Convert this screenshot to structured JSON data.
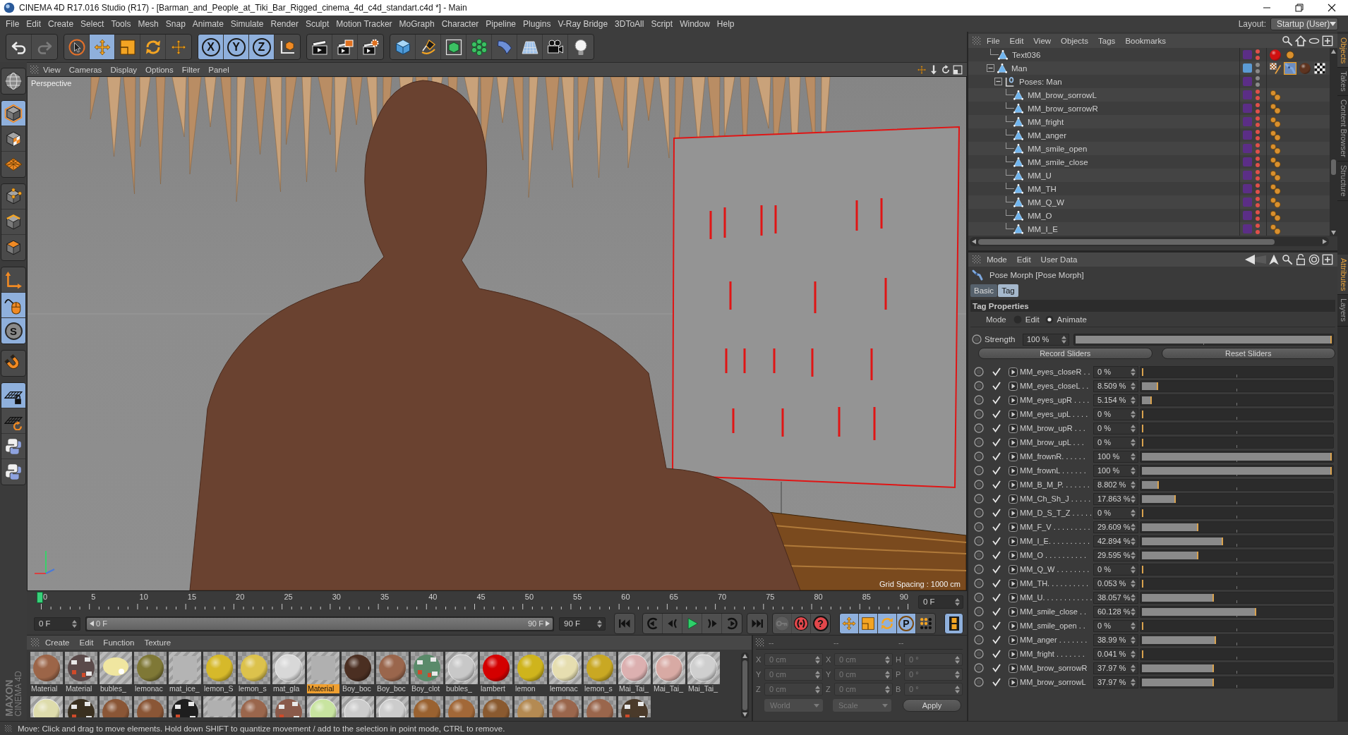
{
  "window": {
    "title": "CINEMA 4D R17.016 Studio (R17) - [Barman_and_People_at_Tiki_Bar_Rigged_cinema_4d_c4d_standart.c4d *] - Main"
  },
  "menu_bar": {
    "items": [
      "File",
      "Edit",
      "Create",
      "Select",
      "Tools",
      "Mesh",
      "Snap",
      "Animate",
      "Simulate",
      "Render",
      "Sculpt",
      "Motion Tracker",
      "MoGraph",
      "Character",
      "Pipeline",
      "Plugins",
      "V-Ray Bridge",
      "3DToAll",
      "Script",
      "Window",
      "Help"
    ],
    "layout_label": "Layout:",
    "layout_value": "Startup (User)"
  },
  "toolbar": {
    "groups": [
      {
        "items": [
          {
            "kind": "undo",
            "disabled": false
          },
          {
            "kind": "redo",
            "disabled": true
          }
        ]
      },
      {
        "items": [
          {
            "kind": "select",
            "selected": false
          },
          {
            "kind": "move",
            "selected": true
          },
          {
            "kind": "scale",
            "selected": false
          },
          {
            "kind": "rotate",
            "selected": false
          },
          {
            "kind": "transform",
            "selected": false
          }
        ]
      },
      {
        "items": [
          {
            "kind": "letter",
            "label": "X",
            "selected": true
          },
          {
            "kind": "letter",
            "label": "Y",
            "selected": true
          },
          {
            "kind": "letter",
            "label": "Z",
            "selected": true
          },
          {
            "kind": "coordinate_system",
            "selected": false
          }
        ]
      },
      {
        "items": [
          {
            "kind": "render_view"
          },
          {
            "kind": "render_picture"
          },
          {
            "kind": "render_settings"
          }
        ]
      },
      {
        "items": [
          {
            "kind": "cube"
          },
          {
            "kind": "pen"
          },
          {
            "kind": "subdivision"
          },
          {
            "kind": "cloner"
          },
          {
            "kind": "deformer"
          },
          {
            "kind": "floor"
          },
          {
            "kind": "camera"
          },
          {
            "kind": "light"
          }
        ]
      }
    ]
  },
  "left_toolbar": {
    "groups": [
      {
        "items": [
          {
            "kind": "globe",
            "selected": false
          }
        ]
      },
      {
        "items": [
          {
            "kind": "model_cube",
            "selected": true
          },
          {
            "kind": "checker_cube",
            "selected": false
          },
          {
            "kind": "grid_plane",
            "selected": false
          }
        ]
      },
      {
        "items": [
          {
            "kind": "cube_points",
            "selected": false
          },
          {
            "kind": "cube_edges",
            "selected": false
          },
          {
            "kind": "cube_faces",
            "selected": false
          }
        ]
      },
      {
        "items": [
          {
            "kind": "axis",
            "selected": false
          },
          {
            "kind": "mouse",
            "selected": true
          },
          {
            "kind": "letter",
            "label": "S",
            "selected": true
          }
        ]
      },
      {
        "items": [
          {
            "kind": "magnet",
            "selected": false
          }
        ]
      },
      {
        "items": [
          {
            "kind": "grid_lock",
            "selected": true
          },
          {
            "kind": "grid_rotate",
            "selected": false
          },
          {
            "kind": "script",
            "selected": false
          },
          {
            "kind": "script",
            "selected": false
          }
        ]
      }
    ],
    "logo": [
      "MAXON",
      "CINEMA 4D"
    ]
  },
  "viewport": {
    "menu": [
      "View",
      "Cameras",
      "Display",
      "Options",
      "Filter",
      "Panel"
    ],
    "camera": "Perspective",
    "grid_spacing": "Grid Spacing : 1000 cm"
  },
  "timeline": {
    "ticks": [
      "0",
      "5",
      "10",
      "15",
      "20",
      "25",
      "30",
      "35",
      "40",
      "45",
      "50",
      "55",
      "60",
      "65",
      "70",
      "75",
      "80",
      "85",
      "90"
    ],
    "level": 0,
    "current_frame": "0 F"
  },
  "transport": {
    "start": "0 F",
    "range": {
      "start": "0 F",
      "end": "90 F",
      "level": 1
    },
    "end": "90 F",
    "playback": [
      {
        "items": [
          {
            "kind": "first"
          }
        ]
      },
      {
        "items": [
          {
            "kind": "prev_key"
          },
          {
            "kind": "prev_frame"
          },
          {
            "kind": "play"
          },
          {
            "kind": "next_frame"
          },
          {
            "kind": "next_key"
          }
        ]
      },
      {
        "items": [
          {
            "kind": "last"
          }
        ]
      }
    ],
    "record": [
      {
        "kind": "key",
        "disabled": true
      },
      {
        "kind": "record",
        "disabled": false
      },
      {
        "kind": "letter",
        "label": "?",
        "disabled": false
      }
    ],
    "keys": [
      {
        "kind": "move",
        "selected": true
      },
      {
        "kind": "scale",
        "selected": true
      },
      {
        "kind": "rotate",
        "selected": true
      },
      {
        "kind": "letter",
        "label": "P",
        "selected": true
      },
      {
        "kind": "points",
        "selected": false
      }
    ],
    "timeline_button": {
      "selected": true
    }
  },
  "material_manager": {
    "menu": [
      "Create",
      "Edit",
      "Function",
      "Texture"
    ],
    "materials": [
      {
        "label": "Material",
        "kind": "sphere",
        "color": "#9c6548",
        "selected": false
      },
      {
        "label": "Material",
        "kind": "texture",
        "color": "#5a4a4a",
        "selected": false
      },
      {
        "label": "bubles_",
        "kind": "glow",
        "color": "#f0e6a0",
        "selected": false
      },
      {
        "label": "lemonac",
        "kind": "sphere",
        "color": "#7f7836",
        "selected": false
      },
      {
        "label": "mat_ice_",
        "kind": "empty",
        "color": "#b4b4b4",
        "selected": false
      },
      {
        "label": "lemon_S",
        "kind": "sphere",
        "color": "#d6b92a",
        "selected": false
      },
      {
        "label": "lemon_s",
        "kind": "sphere",
        "color": "#dcc24c",
        "selected": false
      },
      {
        "label": "mat_gla",
        "kind": "glass",
        "color": "#d8d8d8",
        "selected": false
      },
      {
        "label": "Material",
        "kind": "empty",
        "color": "#b0b0b0",
        "selected": true
      },
      {
        "label": "Boy_boc",
        "kind": "sphere",
        "color": "#4b2f22",
        "selected": false
      },
      {
        "label": "Boy_boc",
        "kind": "sphere",
        "color": "#9a664c",
        "selected": false
      },
      {
        "label": "Boy_clot",
        "kind": "texture",
        "color": "#5a8a6a",
        "selected": false
      },
      {
        "label": "bubles_",
        "kind": "glass",
        "color": "#c8c8c8",
        "selected": false
      },
      {
        "label": "lambert",
        "kind": "sphere",
        "color": "#d40000",
        "selected": false
      },
      {
        "label": "lemon",
        "kind": "sphere",
        "color": "#cfb41c",
        "selected": false
      },
      {
        "label": "lemonac",
        "kind": "glass",
        "color": "#e6deb0",
        "selected": false
      },
      {
        "label": "lemon_s",
        "kind": "sphere",
        "color": "#c9a823",
        "selected": false
      },
      {
        "label": "Mai_Tai_",
        "kind": "glass",
        "color": "#dcb0b0",
        "selected": false
      },
      {
        "label": "Mai_Tai_",
        "kind": "glass",
        "color": "#d8aaa4",
        "selected": false
      },
      {
        "label": "Mai_Tai_",
        "kind": "glass",
        "color": "#cfcfcf",
        "selected": false
      }
    ],
    "more_materials": [
      {
        "kind": "glass",
        "color": "#dedcac"
      },
      {
        "kind": "texture",
        "color": "#3a3020"
      },
      {
        "kind": "sphere",
        "color": "#8a5636"
      },
      {
        "kind": "sphere",
        "color": "#8a5636"
      },
      {
        "kind": "texture",
        "color": "#1e1e1e"
      },
      {
        "kind": "empty",
        "color": "#b0b0b0"
      },
      {
        "kind": "sphere",
        "color": "#9a664c"
      },
      {
        "kind": "texture",
        "color": "#8a5a4a"
      },
      {
        "kind": "glass",
        "color": "#c8e4a0"
      },
      {
        "kind": "glass",
        "color": "#cccccc"
      },
      {
        "kind": "glass",
        "color": "#cccccc"
      },
      {
        "kind": "sphere",
        "color": "#9a6230"
      },
      {
        "kind": "sphere",
        "color": "#a26838"
      },
      {
        "kind": "sphere",
        "color": "#8a5a30"
      },
      {
        "kind": "sphere",
        "color": "#b48a52"
      },
      {
        "kind": "sphere",
        "color": "#9a664c"
      },
      {
        "kind": "sphere",
        "color": "#9a664c"
      },
      {
        "kind": "texture",
        "color": "#4a3a2a"
      }
    ]
  },
  "coordinates": {
    "headers": [
      "--",
      "--",
      "--"
    ],
    "disabled": true,
    "columns": [
      {
        "fields": [
          {
            "axis": "X",
            "value": "0 cm"
          },
          {
            "axis": "Y",
            "value": "0 cm"
          },
          {
            "axis": "Z",
            "value": "0 cm"
          }
        ]
      },
      {
        "fields": [
          {
            "axis": "X",
            "value": "0 cm"
          },
          {
            "axis": "Y",
            "value": "0 cm"
          },
          {
            "axis": "Z",
            "value": "0 cm"
          }
        ]
      },
      {
        "fields": [
          {
            "axis": "H",
            "value": "0 °"
          },
          {
            "axis": "P",
            "value": "0 °"
          },
          {
            "axis": "B",
            "value": "0 °"
          }
        ]
      }
    ],
    "dropdowns": [
      "World",
      "Scale"
    ],
    "apply": "Apply"
  },
  "object_manager": {
    "menu": [
      "File",
      "Edit",
      "View",
      "Objects",
      "Tags",
      "Bookmarks"
    ],
    "tree": [
      {
        "name": "Text036",
        "kind": "polygon",
        "color": "#5b2e86",
        "hidden": true,
        "tags": [
          {
            "kind": "material",
            "color": "#d01010",
            "selected": false
          },
          {
            "kind": "dot",
            "selected": false
          }
        ]
      },
      {
        "name": "Man",
        "kind": "polygon",
        "color": "#5b9bd5",
        "hidden": false,
        "expanded": true,
        "tags": [
          {
            "kind": "ik",
            "selected": false
          },
          {
            "kind": "pose_morph",
            "selected": true
          },
          {
            "kind": "material",
            "color": "#5e3420",
            "selected": false
          },
          {
            "kind": "texture",
            "selected": false
          }
        ],
        "children": [
          {
            "name": "Poses: Man",
            "kind": "pose",
            "color": "#5b2e86",
            "hidden": false,
            "expanded": true,
            "children": [
              {
                "name": "MM_brow_sorrowL",
                "kind": "polygon",
                "color": "#5b2e86",
                "hidden": true,
                "tags": [
                  {
                    "kind": "morph",
                    "selected": false
                  }
                ]
              },
              {
                "name": "MM_brow_sorrowR",
                "kind": "polygon",
                "color": "#5b2e86",
                "hidden": true,
                "tags": [
                  {
                    "kind": "morph",
                    "selected": false
                  }
                ]
              },
              {
                "name": "MM_fright",
                "kind": "polygon",
                "color": "#5b2e86",
                "hidden": true,
                "tags": [
                  {
                    "kind": "morph",
                    "selected": false
                  }
                ]
              },
              {
                "name": "MM_anger",
                "kind": "polygon",
                "color": "#5b2e86",
                "hidden": true,
                "tags": [
                  {
                    "kind": "morph",
                    "selected": false
                  }
                ]
              },
              {
                "name": "MM_smile_open",
                "kind": "polygon",
                "color": "#5b2e86",
                "hidden": true,
                "tags": [
                  {
                    "kind": "morph",
                    "selected": false
                  }
                ]
              },
              {
                "name": "MM_smile_close",
                "kind": "polygon",
                "color": "#5b2e86",
                "hidden": true,
                "tags": [
                  {
                    "kind": "morph",
                    "selected": false
                  }
                ]
              },
              {
                "name": "MM_U",
                "kind": "polygon",
                "color": "#5b2e86",
                "hidden": true,
                "tags": [
                  {
                    "kind": "morph",
                    "selected": false
                  }
                ]
              },
              {
                "name": "MM_TH",
                "kind": "polygon",
                "color": "#5b2e86",
                "hidden": true,
                "tags": [
                  {
                    "kind": "morph",
                    "selected": false
                  }
                ]
              },
              {
                "name": "MM_Q_W",
                "kind": "polygon",
                "color": "#5b2e86",
                "hidden": true,
                "tags": [
                  {
                    "kind": "morph",
                    "selected": false
                  }
                ]
              },
              {
                "name": "MM_O",
                "kind": "polygon",
                "color": "#5b2e86",
                "hidden": true,
                "tags": [
                  {
                    "kind": "morph",
                    "selected": false
                  }
                ]
              },
              {
                "name": "MM_I_E",
                "kind": "polygon",
                "color": "#5b2e86",
                "hidden": true,
                "tags": [
                  {
                    "kind": "morph",
                    "selected": false
                  }
                ]
              }
            ]
          }
        ]
      }
    ]
  },
  "attributes": {
    "menu": [
      "Mode",
      "Edit",
      "User Data"
    ],
    "title": "Pose Morph [Pose Morph]",
    "tabs": [
      {
        "label": "Basic",
        "selected": false
      },
      {
        "label": "Tag",
        "selected": true
      }
    ],
    "section": "Tag Properties",
    "mode": {
      "label": "Mode",
      "options": [
        {
          "label": "Edit",
          "selected": false
        },
        {
          "label": "Animate",
          "selected": true
        }
      ]
    },
    "strength": {
      "label": "Strength",
      "value": "100 %",
      "level": 1
    },
    "buttons": [
      "Record Sliders",
      "Reset Sliders"
    ],
    "sliders": [
      {
        "name": "MM_eyes_closeR . .",
        "checked": true,
        "value": "0 %",
        "level": 0
      },
      {
        "name": "MM_eyes_closeL . .",
        "checked": true,
        "value": "8.509 %",
        "level": 0.08509
      },
      {
        "name": "MM_eyes_upR . . . .",
        "checked": true,
        "value": "5.154 %",
        "level": 0.05154
      },
      {
        "name": "MM_eyes_upL . . . .",
        "checked": true,
        "value": "0 %",
        "level": 0
      },
      {
        "name": "MM_brow_upR . . .",
        "checked": true,
        "value": "0 %",
        "level": 0
      },
      {
        "name": "MM_brow_upL . . .",
        "checked": true,
        "value": "0 %",
        "level": 0
      },
      {
        "name": "MM_frownR. . . . . .",
        "checked": true,
        "value": "100 %",
        "level": 1
      },
      {
        "name": "MM_frownL . . . . . .",
        "checked": true,
        "value": "100 %",
        "level": 1
      },
      {
        "name": "MM_B_M_P. . . . . . .",
        "checked": true,
        "value": "8.802 %",
        "level": 0.08802
      },
      {
        "name": "MM_Ch_Sh_J . . . . .",
        "checked": true,
        "value": "17.863 %",
        "level": 0.17863
      },
      {
        "name": "MM_D_S_T_Z . . . . .",
        "checked": true,
        "value": "0 %",
        "level": 0
      },
      {
        "name": "MM_F_V . . . . . . . . .",
        "checked": true,
        "value": "29.609 %",
        "level": 0.29609
      },
      {
        "name": "MM_I_E. . . . . . . . . .",
        "checked": true,
        "value": "42.894 %",
        "level": 0.42894
      },
      {
        "name": "MM_O . . . . . . . . . .",
        "checked": true,
        "value": "29.595 %",
        "level": 0.29595
      },
      {
        "name": "MM_Q_W . . . . . . . .",
        "checked": true,
        "value": "0 %",
        "level": 0
      },
      {
        "name": "MM_TH. . . . . . . . . .",
        "checked": true,
        "value": "0.053 %",
        "level": 0.00053
      },
      {
        "name": "MM_U. . . . . . . . . . . .",
        "checked": true,
        "value": "38.057 %",
        "level": 0.38057
      },
      {
        "name": "MM_smile_close . .",
        "checked": true,
        "value": "60.128 %",
        "level": 0.60128
      },
      {
        "name": "MM_smile_open . .",
        "checked": true,
        "value": "0 %",
        "level": 0
      },
      {
        "name": "MM_anger . . . . . . .",
        "checked": true,
        "value": "38.99 %",
        "level": 0.3899
      },
      {
        "name": "MM_fright . . . . . . .",
        "checked": true,
        "value": "0.041 %",
        "level": 0.00041
      },
      {
        "name": "MM_brow_sorrowR",
        "checked": true,
        "value": "37.97 %",
        "level": 0.3797
      },
      {
        "name": "MM_brow_sorrowL",
        "checked": true,
        "value": "37.97 %",
        "level": 0.3797
      }
    ]
  },
  "side_tabs": {
    "top": [
      {
        "label": "Objects",
        "selected": true
      },
      {
        "label": "Takes",
        "selected": false
      },
      {
        "label": "Content Browser",
        "selected": false
      },
      {
        "label": "Structure",
        "selected": false
      }
    ],
    "bottom": [
      {
        "label": "Attributes",
        "selected": true
      },
      {
        "label": "Layers",
        "selected": false
      }
    ]
  },
  "status_bar": {
    "text": "Move: Click and drag to move elements. Hold down SHIFT to quantize movement / add to the selection in point mode, CTRL to remove."
  }
}
